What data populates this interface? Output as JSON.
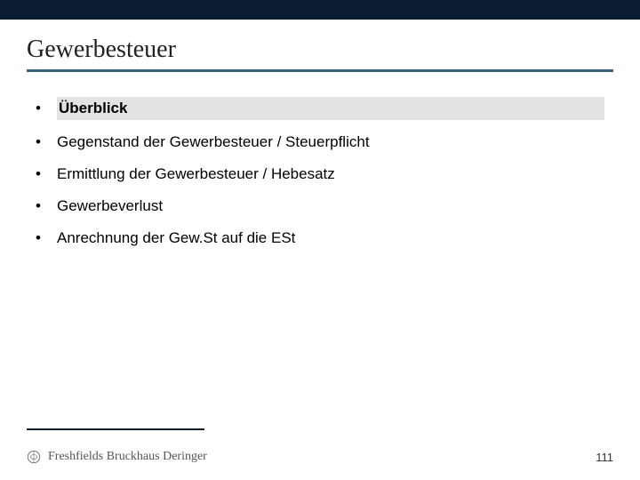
{
  "title": "Gewerbesteuer",
  "items": [
    {
      "label": "Überblick",
      "highlight": true
    },
    {
      "label": "Gegenstand der Gewerbesteuer / Steuerpflicht",
      "highlight": false
    },
    {
      "label": "Ermittlung der Gewerbesteuer / Hebesatz",
      "highlight": false
    },
    {
      "label": "Gewerbeverlust",
      "highlight": false
    },
    {
      "label": "Anrechnung der Gew.St auf die ESt",
      "highlight": false
    }
  ],
  "brand": "Freshfields Bruckhaus Deringer",
  "page_number": "111"
}
